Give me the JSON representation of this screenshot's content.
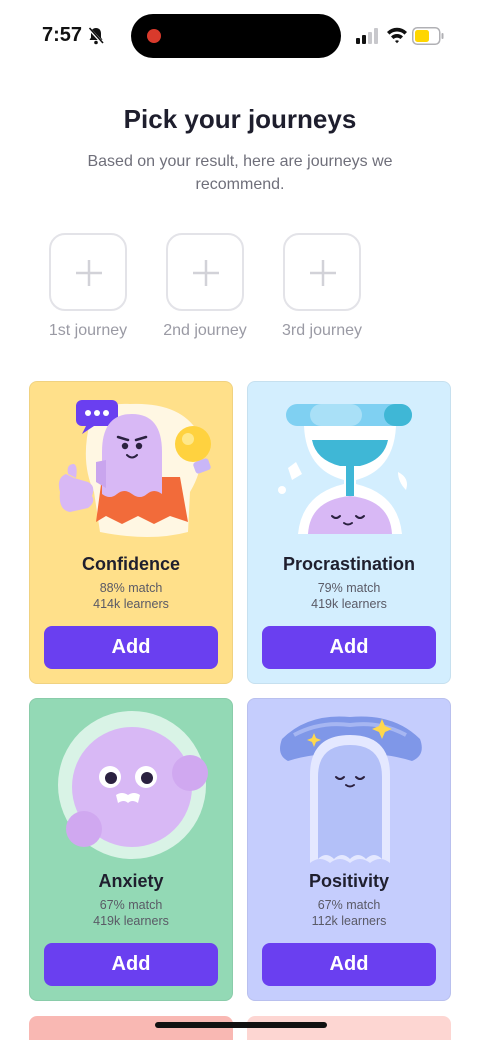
{
  "status_bar": {
    "time": "7:57",
    "battery_color": "#ffd600"
  },
  "header": {
    "title": "Pick your journeys",
    "subtitle": "Based on your result, here are journeys we recommend."
  },
  "slots": [
    {
      "label": "1st journey",
      "icon": "plus-icon"
    },
    {
      "label": "2nd journey",
      "icon": "plus-icon"
    },
    {
      "label": "3rd journey",
      "icon": "plus-icon"
    }
  ],
  "cards": [
    {
      "title": "Confidence",
      "match": "88% match",
      "learners": "414k learners",
      "button": "Add",
      "bg": "#ffe08a"
    },
    {
      "title": "Procrastination",
      "match": "79% match",
      "learners": "419k learners",
      "button": "Add",
      "bg": "#d3eefe"
    },
    {
      "title": "Anxiety",
      "match": "67% match",
      "learners": "419k learners",
      "button": "Add",
      "bg": "#93d9b5"
    },
    {
      "title": "Positivity",
      "match": "67% match",
      "learners": "112k learners",
      "button": "Add",
      "bg": "#c5cdfd"
    }
  ],
  "accent_color": "#6a3ff0"
}
